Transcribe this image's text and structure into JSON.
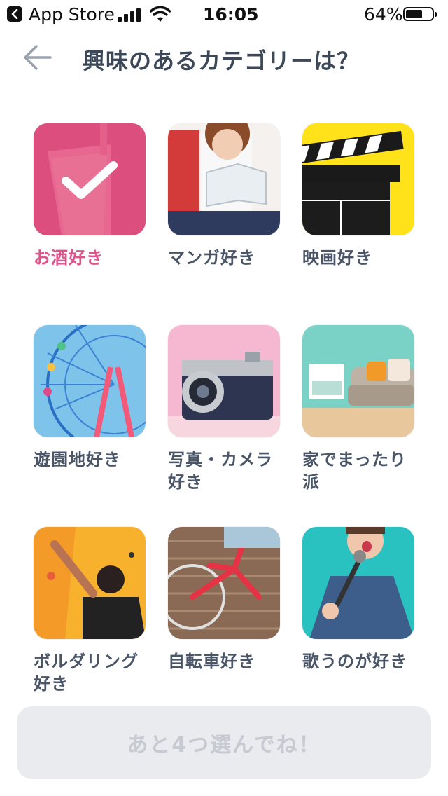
{
  "status_bar": {
    "back_app_label": "App Store",
    "time": "16:05",
    "battery": "64%",
    "battery_level": 0.64
  },
  "header": {
    "title": "興味のあるカテゴリーは？",
    "back_icon": "arrow-left-icon"
  },
  "categories": [
    {
      "label": "お酒好き",
      "selected": true
    },
    {
      "label": "マンガ好き",
      "selected": false
    },
    {
      "label": "映画好き",
      "selected": false
    },
    {
      "label": "遊園地好き",
      "selected": false
    },
    {
      "label": "写真・カメラ好き",
      "selected": false
    },
    {
      "label": "家でまったり派",
      "selected": false
    },
    {
      "label": "ボルダリング好き",
      "selected": false
    },
    {
      "label": "自転車好き",
      "selected": false
    },
    {
      "label": "歌うのが好き",
      "selected": false
    }
  ],
  "footer": {
    "button_label": "あと4つ選んでね！"
  },
  "colors": {
    "accent": "#e0548b",
    "text": "#3c4858",
    "button_bg": "#e9ebee",
    "button_text": "#c7cbd1"
  }
}
